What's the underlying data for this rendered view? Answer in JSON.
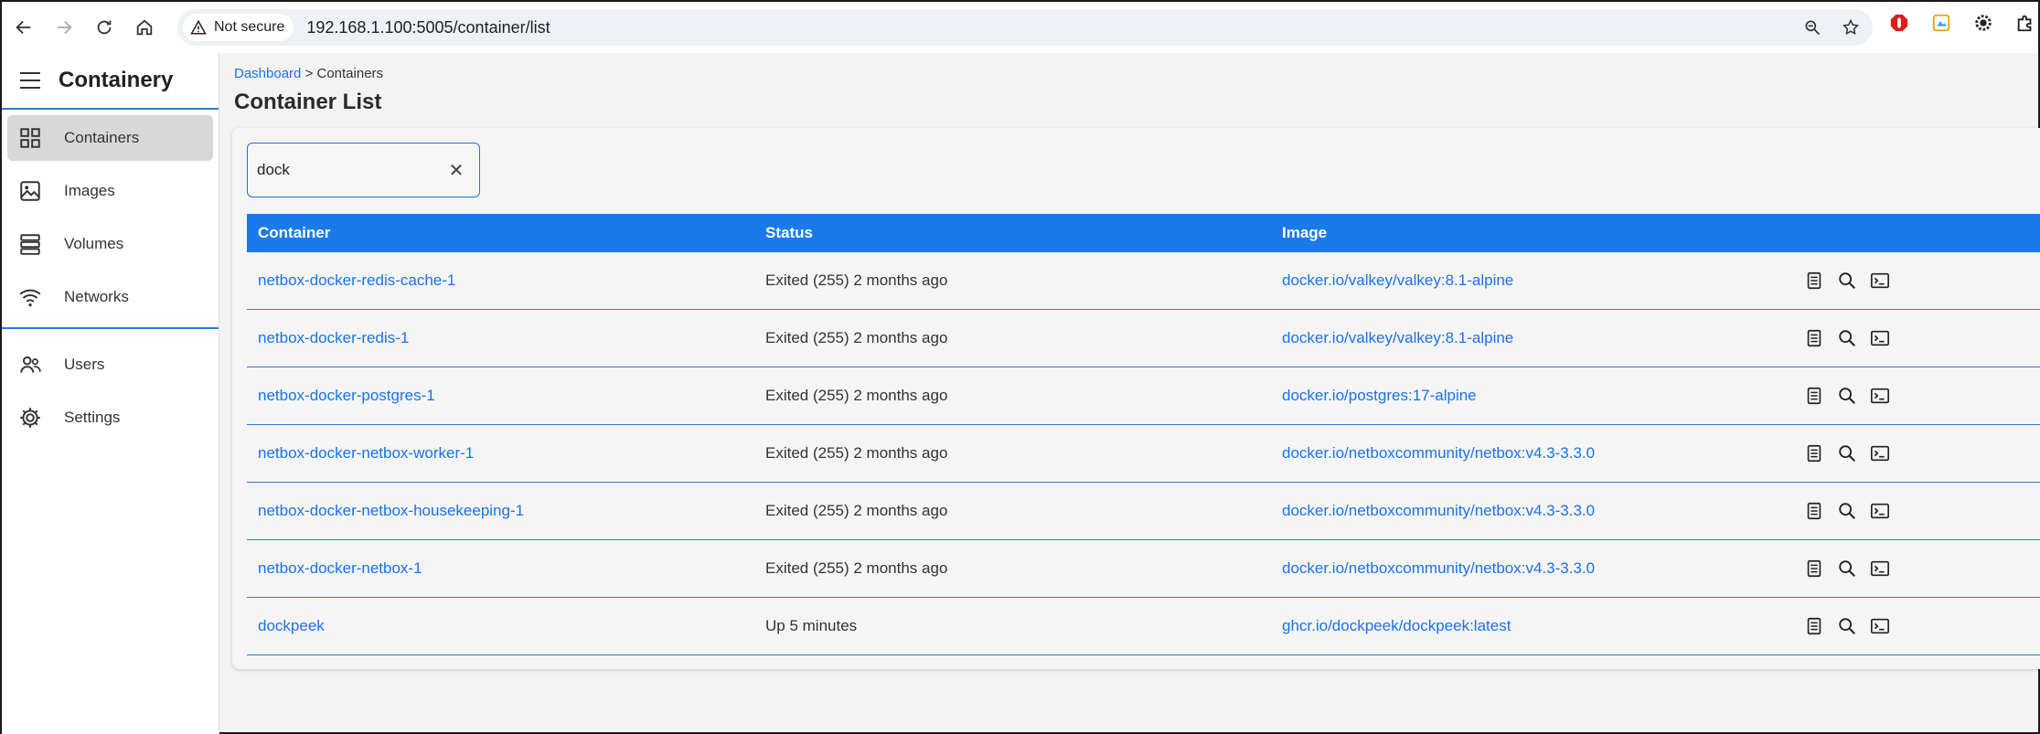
{
  "browser": {
    "security_label": "Not secure",
    "url_host": "192.168.1.100",
    "url_rest": ":5005/container/list"
  },
  "app": {
    "title": "Containery"
  },
  "sidebar": {
    "items": [
      {
        "label": "Containers",
        "icon": "grid-icon",
        "active": true
      },
      {
        "label": "Images",
        "icon": "image-icon",
        "active": false
      },
      {
        "label": "Volumes",
        "icon": "database-icon",
        "active": false
      },
      {
        "label": "Networks",
        "icon": "wifi-icon",
        "active": false
      }
    ],
    "secondary_items": [
      {
        "label": "Users",
        "icon": "users-icon"
      },
      {
        "label": "Settings",
        "icon": "gear-icon"
      }
    ]
  },
  "breadcrumb": {
    "root": "Dashboard",
    "separator": ">",
    "current": "Containers"
  },
  "page": {
    "title": "Container List"
  },
  "search": {
    "value": "dock",
    "clear_icon": "close-icon"
  },
  "table": {
    "headers": [
      "Container",
      "Status",
      "Image"
    ],
    "rows": [
      {
        "container": "netbox-docker-redis-cache-1",
        "status": "Exited (255) 2 months ago",
        "image": "docker.io/valkey/valkey:8.1-alpine"
      },
      {
        "container": "netbox-docker-redis-1",
        "status": "Exited (255) 2 months ago",
        "image": "docker.io/valkey/valkey:8.1-alpine"
      },
      {
        "container": "netbox-docker-postgres-1",
        "status": "Exited (255) 2 months ago",
        "image": "docker.io/postgres:17-alpine"
      },
      {
        "container": "netbox-docker-netbox-worker-1",
        "status": "Exited (255) 2 months ago",
        "image": "docker.io/netboxcommunity/netbox:v4.3-3.3.0"
      },
      {
        "container": "netbox-docker-netbox-housekeeping-1",
        "status": "Exited (255) 2 months ago",
        "image": "docker.io/netboxcommunity/netbox:v4.3-3.3.0"
      },
      {
        "container": "netbox-docker-netbox-1",
        "status": "Exited (255) 2 months ago",
        "image": "docker.io/netboxcommunity/netbox:v4.3-3.3.0"
      },
      {
        "container": "dockpeek",
        "status": "Up 5 minutes",
        "image": "ghcr.io/dockpeek/dockpeek:latest"
      }
    ],
    "row_actions": [
      "logs-icon",
      "inspect-icon",
      "terminal-icon"
    ]
  },
  "colors": {
    "accent": "#1a7ae8",
    "link": "#1a73e8",
    "active_nav_bg": "#d8d8d8"
  }
}
